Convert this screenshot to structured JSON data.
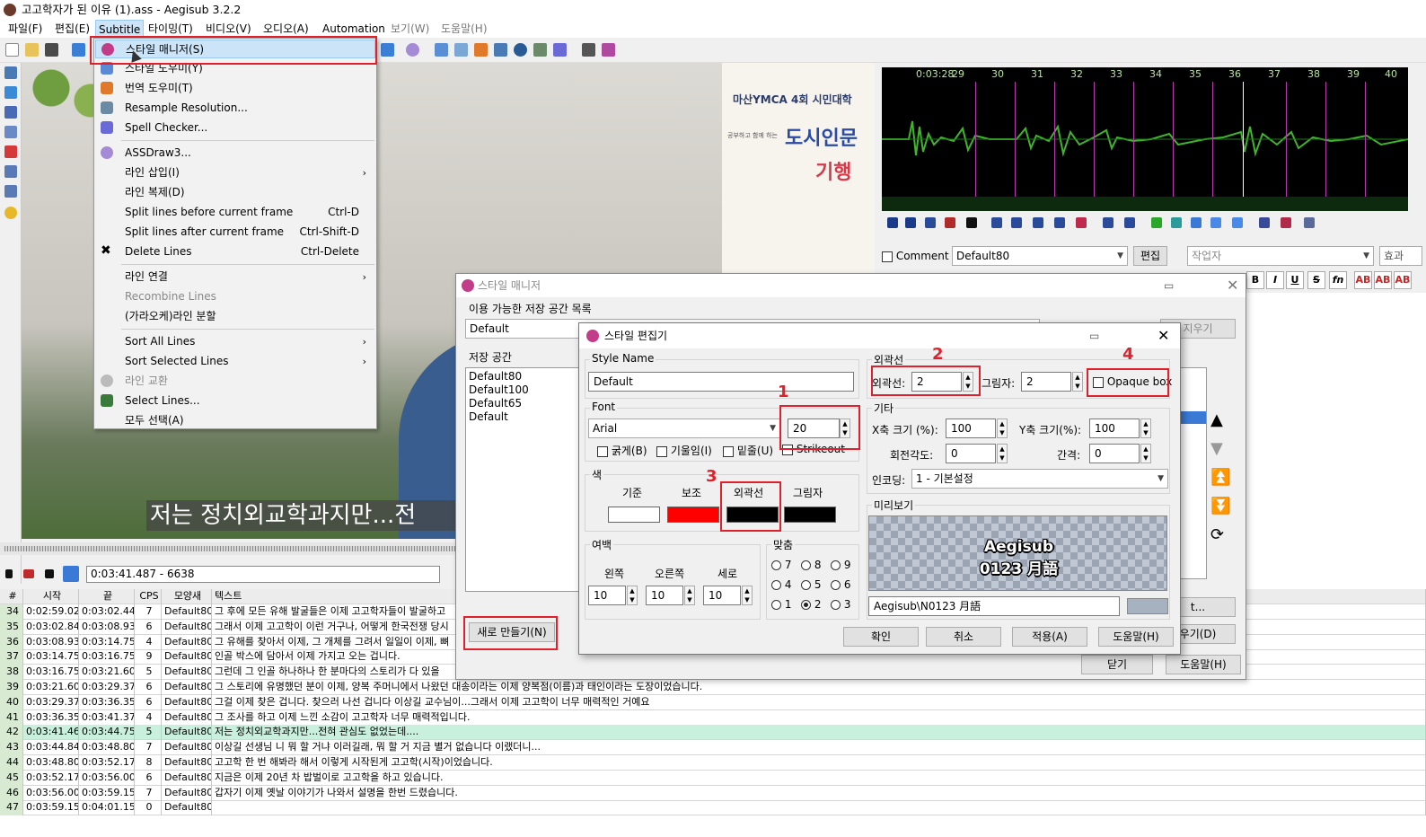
{
  "window": {
    "title": "고고학자가 된 이유 (1).ass - Aegisub 3.2.2"
  },
  "menubar": [
    {
      "label": "파일(F)",
      "state": "normal"
    },
    {
      "label": "편집(E)",
      "state": "normal"
    },
    {
      "label": "Subtitle",
      "state": "open"
    },
    {
      "label": "타이밍(T)",
      "state": "normal"
    },
    {
      "label": "비디오(V)",
      "state": "normal"
    },
    {
      "label": "오디오(A)",
      "state": "normal"
    },
    {
      "label": "Automation",
      "state": "normal"
    },
    {
      "label": "보기(W)",
      "state": "dim"
    },
    {
      "label": "도움말(H)",
      "state": "dim"
    }
  ],
  "subtitle_menu": [
    {
      "label": "스타일 매니저(S)",
      "shortcut": "",
      "highlighted": true,
      "disabled": false,
      "icon": "style-manager-icon"
    },
    {
      "label": "스타일 도우미(Y)",
      "shortcut": "",
      "disabled": false,
      "icon": "style-assistant-icon"
    },
    {
      "label": "번역 도우미(T)",
      "shortcut": "",
      "disabled": false,
      "icon": "translation-assistant-icon"
    },
    {
      "label": "Resample Resolution...",
      "shortcut": "",
      "disabled": false,
      "icon": "resample-icon"
    },
    {
      "label": "Spell Checker...",
      "shortcut": "",
      "disabled": false,
      "icon": "spell-check-icon"
    },
    {
      "label": "ASSDraw3...",
      "shortcut": "",
      "disabled": false,
      "icon": "assdraw-icon"
    },
    {
      "label": "라인 삽입(I)",
      "shortcut": "",
      "disabled": false,
      "submenu": true
    },
    {
      "label": "라인 복제(D)",
      "shortcut": "",
      "disabled": false
    },
    {
      "label": "Split lines before current frame",
      "shortcut": "Ctrl-D",
      "disabled": false
    },
    {
      "label": "Split lines after current frame",
      "shortcut": "Ctrl-Shift-D",
      "disabled": false
    },
    {
      "label": "Delete Lines",
      "shortcut": "Ctrl-Delete",
      "disabled": false,
      "icon": "delete-icon"
    },
    {
      "label": "라인 연결",
      "shortcut": "",
      "disabled": false,
      "submenu": true
    },
    {
      "label": "Recombine Lines",
      "shortcut": "",
      "disabled": true
    },
    {
      "label": "(가라오케)라인 분할",
      "shortcut": "",
      "disabled": false
    },
    {
      "label": "Sort All Lines",
      "shortcut": "",
      "disabled": false,
      "submenu": true
    },
    {
      "label": "Sort Selected Lines",
      "shortcut": "",
      "disabled": false,
      "submenu": true
    },
    {
      "label": "라인 교환",
      "shortcut": "",
      "disabled": true,
      "icon": "swap-icon"
    },
    {
      "label": "Select Lines...",
      "shortcut": "",
      "disabled": false,
      "icon": "select-lines-icon"
    },
    {
      "label": "모두 선택(A)",
      "shortcut": "",
      "disabled": false
    }
  ],
  "video": {
    "poster_line1": "마산YMCA 4회 시민대학",
    "poster_small": "공부하고 함께 하는",
    "poster_big1": "도시인문",
    "poster_big2": "기행",
    "subtitle_text": "저는 정치외교학과지만...전"
  },
  "audio": {
    "ruler_labels": [
      "0:03:28",
      "29",
      "30",
      "31",
      "32",
      "33",
      "34",
      "35",
      "36",
      "37",
      "38",
      "39",
      "40"
    ]
  },
  "edit": {
    "comment_label": "Comment",
    "style_value": "Default80",
    "edit_button": "편집",
    "actor_placeholder": "작업자",
    "effect_label": "효과",
    "format_buttons": [
      "B",
      "I",
      "U",
      "S",
      "fn",
      "AB",
      "AB",
      "AB",
      "AB"
    ]
  },
  "video_time": "0:03:41.487 - 6638",
  "grid": {
    "headers": [
      "#",
      "시작",
      "끝",
      "CPS",
      "모양새",
      "텍스트"
    ],
    "rows": [
      {
        "n": "34",
        "start": "0:02:59.02",
        "end": "0:03:02.44",
        "cps": "7",
        "style": "Default80",
        "text": "그 후에 모든 유해 발굴들은 이제 고고학자들이 발굴하고"
      },
      {
        "n": "35",
        "start": "0:03:02.84",
        "end": "0:03:08.93",
        "cps": "6",
        "style": "Default80",
        "text": "그래서 이제 고고학이 이런 거구나, 어떻게 한국전쟁 당시"
      },
      {
        "n": "36",
        "start": "0:03:08.93",
        "end": "0:03:14.75",
        "cps": "4",
        "style": "Default80",
        "text": "그 유해를 찾아서 이제, 그 개체를 그려서 일일이 이제, 뼈"
      },
      {
        "n": "37",
        "start": "0:03:14.75",
        "end": "0:03:16.75",
        "cps": "9",
        "style": "Default80",
        "text": "인골 박스에 담아서 이제 가지고 오는 겁니다."
      },
      {
        "n": "38",
        "start": "0:03:16.75",
        "end": "0:03:21.60",
        "cps": "5",
        "style": "Default80",
        "text": "그런데 그 인골 하나하나 한 분마다의 스토리가 다 있을"
      },
      {
        "n": "39",
        "start": "0:03:21.60",
        "end": "0:03:29.37",
        "cps": "6",
        "style": "Default80",
        "text": "그 스토리에 유명했던 분이 이제, 양복 주머니에서 나왔던 대송이라는 이제 양복점(이름)과 태인이라는 도장이었습니다."
      },
      {
        "n": "40",
        "start": "0:03:29.37",
        "end": "0:03:36.35",
        "cps": "6",
        "style": "Default80",
        "text": "그걸 이제 찾은 겁니다. 찾으러 나선 겁니다 이상길 교수님이...그래서 이제 고고학이 너무 매력적인 거예요"
      },
      {
        "n": "41",
        "start": "0:03:36.35",
        "end": "0:03:41.37",
        "cps": "4",
        "style": "Default80",
        "text": "그 조사를 하고 이제 느낀 소감이 고고학자 너무 매력적입니다."
      },
      {
        "n": "42",
        "start": "0:03:41.46",
        "end": "0:03:44.75",
        "cps": "5",
        "style": "Default80",
        "text": "저는 정치외교학과지만...전혀 관심도 없었는데...."
      },
      {
        "n": "43",
        "start": "0:03:44.84",
        "end": "0:03:48.80",
        "cps": "7",
        "style": "Default80",
        "text": "이상길 선생님 니 뭐 할 거냐 이러길래, 뭐 할 거 지금 별거 없습니다 이랬더니..."
      },
      {
        "n": "44",
        "start": "0:03:48.80",
        "end": "0:03:52.17",
        "cps": "8",
        "style": "Default80",
        "text": "고고학 한 번 해봐라 해서 이렇게 시작된게 고고학(시작)이었습니다."
      },
      {
        "n": "45",
        "start": "0:03:52.17",
        "end": "0:03:56.00",
        "cps": "6",
        "style": "Default80",
        "text": "지금은 이제 20년 차 밥벌이로 고고학을 하고 있습니다."
      },
      {
        "n": "46",
        "start": "0:03:56.00",
        "end": "0:03:59.15",
        "cps": "7",
        "style": "Default80",
        "text": "갑자기 이제 옛날 이야기가 나와서 설명을 한번 드렸습니다."
      },
      {
        "n": "47",
        "start": "0:03:59.15",
        "end": "0:04:01.15",
        "cps": "0",
        "style": "Default80",
        "text": ""
      }
    ],
    "current_row": "42"
  },
  "style_manager": {
    "title": "스타일 매니저",
    "catalog_label": "이용 가능한 저장 공간 목록",
    "catalog_value": "Default",
    "delete_button": "지우기",
    "storage_label": "저장 공간",
    "storage_items": [
      "Default80",
      "Default100",
      "Default65",
      "Default"
    ],
    "new_button": "새로 만들기(N)",
    "close_button": "닫기",
    "help_button": "도움말(H)",
    "right_button_1": "t...",
    "right_button_2": "우기(D)"
  },
  "style_editor": {
    "title": "스타일 편집기",
    "style_name_label": "Style Name",
    "style_name_value": "Default",
    "font_label": "Font",
    "font_value": "Arial",
    "font_size": "20",
    "bold": "굵게(B)",
    "italic": "기울임(I)",
    "underline": "밑줄(U)",
    "strikeout": "Strikeout",
    "colors_label": "색",
    "color_labels": [
      "기준",
      "보조",
      "외곽선",
      "그림자"
    ],
    "colors": [
      "#ffffff",
      "#ff0000",
      "#000000",
      "#000000"
    ],
    "margins_label": "여백",
    "margin_labels": [
      "왼쪽",
      "오른쪽",
      "세로"
    ],
    "margin_values": [
      "10",
      "10",
      "10"
    ],
    "alignment_label": "맞춤",
    "alignment_options": [
      "7",
      "8",
      "9",
      "4",
      "5",
      "6",
      "1",
      "2",
      "3"
    ],
    "alignment_selected": "2",
    "outline_group": "외곽선",
    "outline_label": "외곽선:",
    "outline_value": "2",
    "shadow_label": "그림자:",
    "shadow_value": "2",
    "opaque_box": "Opaque box",
    "misc_group": "기타",
    "scale_x_label": "X축 크기 (%):",
    "scale_x_value": "100",
    "scale_y_label": "Y축 크기(%):",
    "scale_y_value": "100",
    "rotation_label": "회전각도:",
    "rotation_value": "0",
    "spacing_label": "간격:",
    "spacing_value": "0",
    "encoding_label": "인코딩:",
    "encoding_value": "1 - 기본설정",
    "preview_label": "미리보기",
    "preview_line1": "Aegisub",
    "preview_line2": "0123 月語",
    "preview_text": "Aegisub\\N0123 月語",
    "ok": "확인",
    "cancel": "취소",
    "apply": "적용(A)",
    "help": "도움말(H)"
  },
  "annotations": [
    "1",
    "2",
    "3",
    "4"
  ]
}
